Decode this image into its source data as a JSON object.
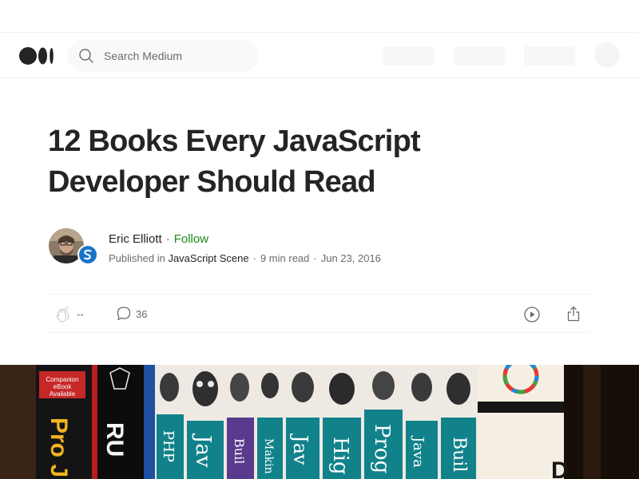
{
  "header": {
    "logo_name": "medium-logo",
    "search": {
      "placeholder": "Search Medium",
      "value": ""
    }
  },
  "article": {
    "title_line1": "12 Books Every JavaScript",
    "title_line2": "Developer Should Read",
    "author": {
      "name": "Eric Elliott",
      "follow_label": "Follow",
      "separator": "·"
    },
    "meta": {
      "published_in_label": "Published in",
      "publication": "JavaScript Scene",
      "read_time": "9 min read",
      "date": "Jun 23, 2016",
      "separator": "·"
    },
    "actions": {
      "claps": "--",
      "responses": "36"
    }
  },
  "hero_image": {
    "spine_texts": [
      "Companion",
      "eBook",
      "Available",
      "Pro J",
      "RU",
      "PHP",
      "Jav",
      "Buil",
      "Makin",
      "Jav",
      "Hig",
      "Prog",
      "Java",
      "Buil",
      "D"
    ]
  },
  "colors": {
    "text_primary": "#242424",
    "text_secondary": "#6b6b6b",
    "follow_green": "#1a8917",
    "divider": "#f2f2f2",
    "publication_badge": "#1a73c9"
  }
}
